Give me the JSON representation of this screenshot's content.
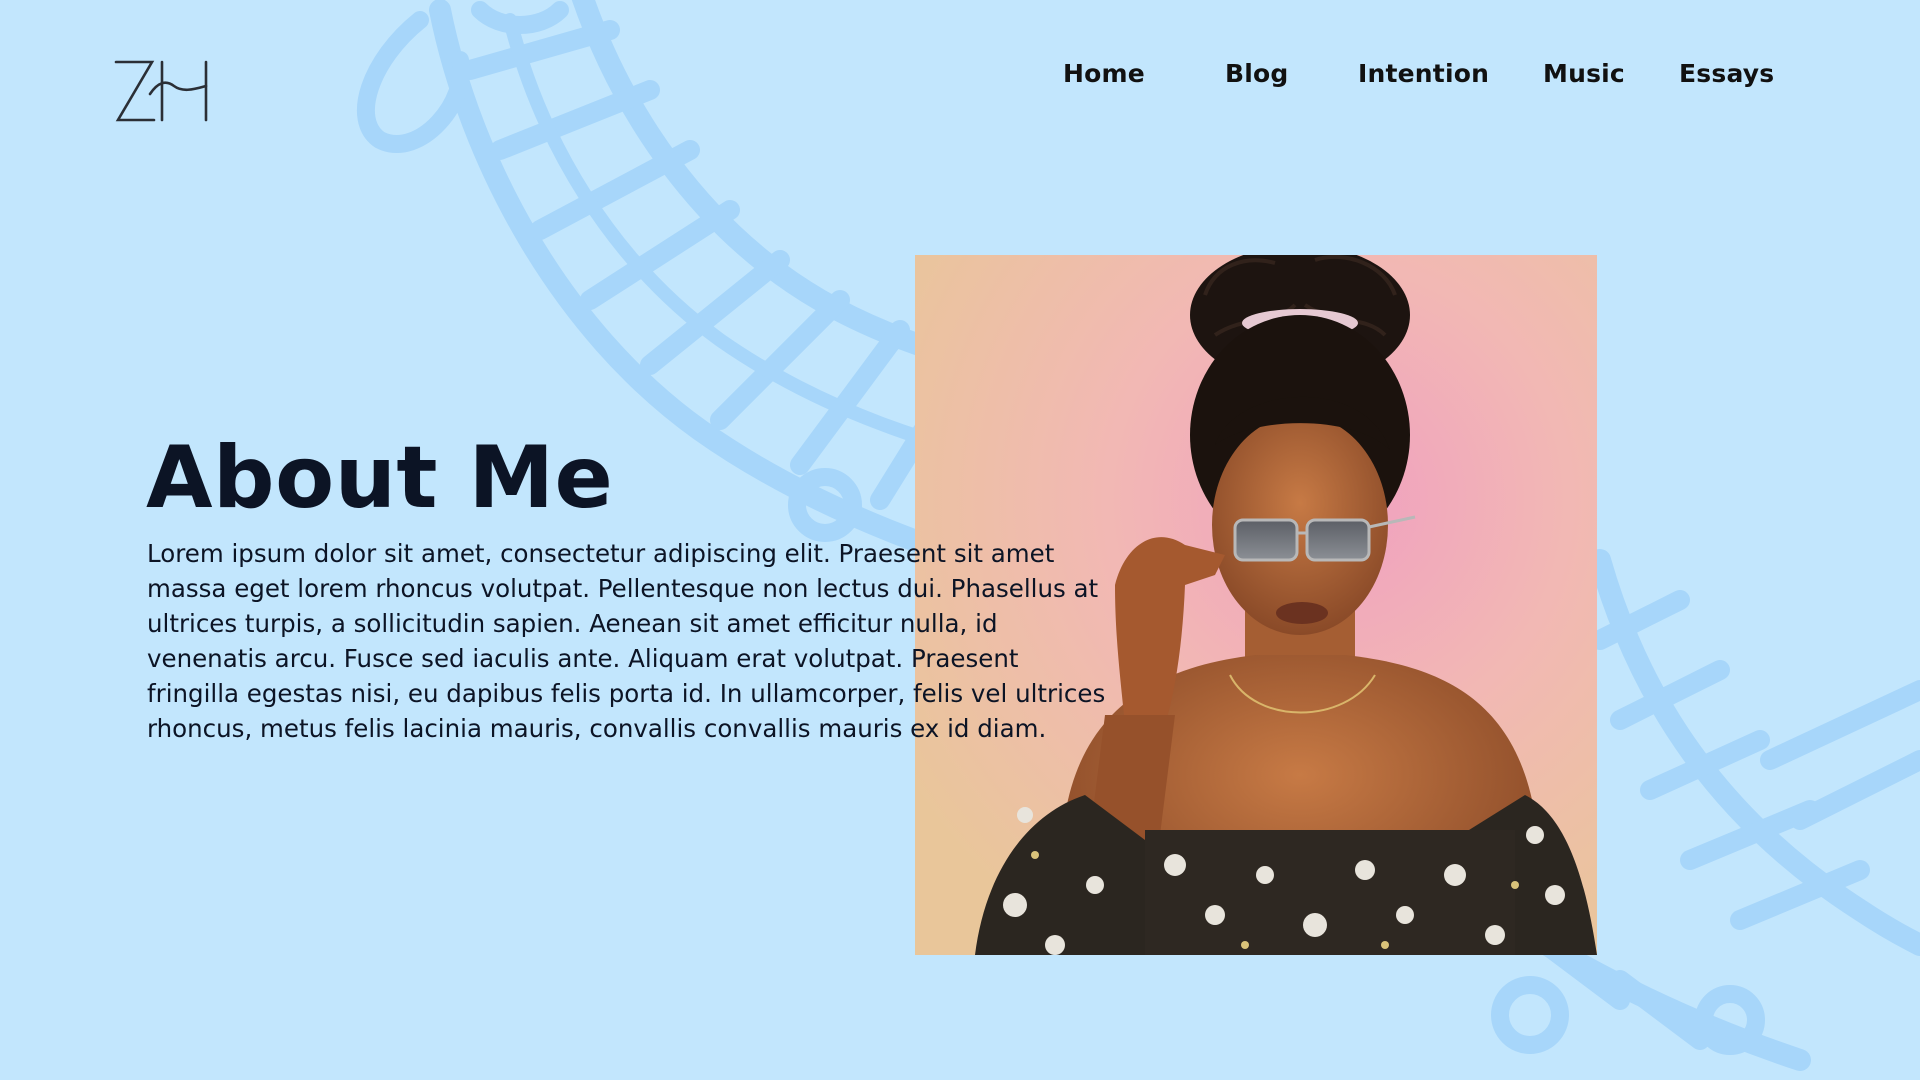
{
  "colors": {
    "background": "#c2e6fd",
    "decoration": "#a7d6fa",
    "text": "#0c1425",
    "nav_text": "#111111"
  },
  "logo": {
    "text": "ZH",
    "icon": "zh-monogram-logo"
  },
  "nav": {
    "items": [
      {
        "label": "Home"
      },
      {
        "label": "Blog"
      },
      {
        "label": "Intention"
      },
      {
        "label": "Music"
      },
      {
        "label": "Essays"
      }
    ]
  },
  "main": {
    "title": "About Me",
    "body": "Lorem ipsum dolor sit amet, consectetur adipiscing elit. Praesent sit amet massa eget lorem rhoncus volutpat. Pellentesque non lectus dui. Phasellus at ultrices turpis, a sollicitudin sapien. Aenean sit amet efficitur nulla, id venenatis arcu. Fusce sed iaculis ante. Aliquam erat volutpat. Praesent fringilla egestas nisi, eu dapibus felis porta id. In ullamcorper, felis vel ultrices rhoncus, metus felis lacinia mauris, convallis convallis mauris ex id diam."
  },
  "photo": {
    "subject": "portrait-photo"
  }
}
